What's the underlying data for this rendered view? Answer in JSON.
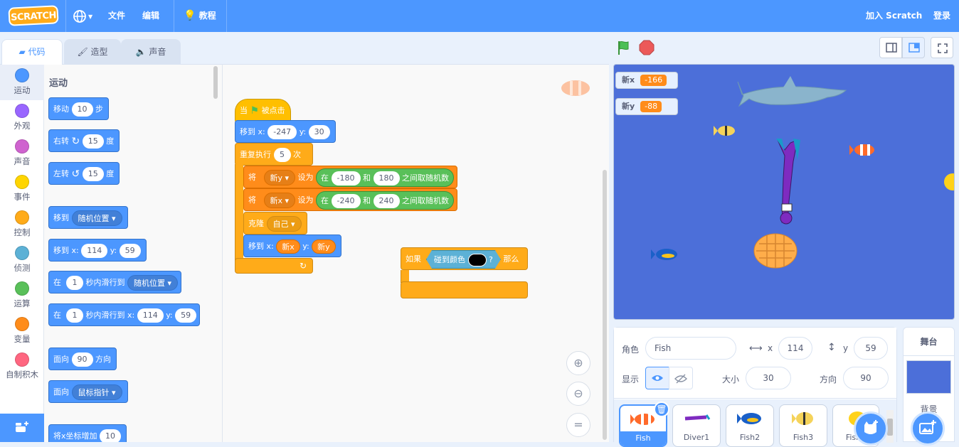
{
  "menubar": {
    "logo": "SCRATCH",
    "file": "文件",
    "edit": "编辑",
    "tutorials": "教程",
    "join": "加入 Scratch",
    "signin": "登录"
  },
  "tabs": {
    "code": "代码",
    "costumes": "造型",
    "sounds": "声音"
  },
  "categories": [
    {
      "label": "运动",
      "color": "#4c97ff"
    },
    {
      "label": "外观",
      "color": "#9966ff"
    },
    {
      "label": "声音",
      "color": "#cf63cf"
    },
    {
      "label": "事件",
      "color": "#ffd500"
    },
    {
      "label": "控制",
      "color": "#ffab19"
    },
    {
      "label": "侦测",
      "color": "#5cb1d6"
    },
    {
      "label": "运算",
      "color": "#59c059"
    },
    {
      "label": "变量",
      "color": "#ff8c1a"
    },
    {
      "label": "自制积木",
      "color": "#ff6680"
    }
  ],
  "palette": {
    "heading": "运动",
    "move": {
      "a": "移动",
      "v": "10",
      "b": "步"
    },
    "turn_right": {
      "a": "右转",
      "v": "15",
      "b": "度"
    },
    "turn_left": {
      "a": "左转",
      "v": "15",
      "b": "度"
    },
    "goto": {
      "a": "移到",
      "dd": "随机位置"
    },
    "gotoxy": {
      "a": "移到 x:",
      "x": "114",
      "yl": "y:",
      "y": "59"
    },
    "glide": {
      "a": "在",
      "v": "1",
      "b": "秒内滑行到",
      "dd": "随机位置"
    },
    "glidexy": {
      "a": "在",
      "v": "1",
      "b": "秒内滑行到 x:",
      "x": "114",
      "yl": "y:",
      "y": "59"
    },
    "point": {
      "a": "面向",
      "v": "90",
      "b": "方向"
    },
    "pointto": {
      "a": "面向",
      "dd": "鼠标指针"
    },
    "changex": {
      "a": "将x坐标增加",
      "v": "10"
    }
  },
  "script": {
    "hat": {
      "a": "当",
      "b": "被点击"
    },
    "gotoxy": {
      "a": "移到 x:",
      "x": "-247",
      "yl": "y:",
      "y": "30"
    },
    "repeat": {
      "a": "重复执行",
      "v": "5",
      "b": "次"
    },
    "sety": {
      "a": "将",
      "var": "新y",
      "b": "设为",
      "c": "在",
      "lo": "-180",
      "and": "和",
      "hi": "180",
      "d": "之间取随机数"
    },
    "setx": {
      "a": "将",
      "var": "新x",
      "b": "设为",
      "c": "在",
      "lo": "-240",
      "and": "和",
      "hi": "240",
      "d": "之间取随机数"
    },
    "clone": {
      "a": "克隆",
      "dd": "自己"
    },
    "goto2": {
      "a": "移到 x:",
      "x": "新x",
      "yl": "y:",
      "y": "新y"
    },
    "if": {
      "a": "如果",
      "touch": "碰到颜色",
      "q": "?",
      "b": "那么"
    }
  },
  "stage": {
    "monitors": [
      {
        "label": "新x",
        "value": "-166"
      },
      {
        "label": "新y",
        "value": "-88"
      }
    ]
  },
  "sprite_info": {
    "sprite_label": "角色",
    "name": "Fish",
    "x_label": "x",
    "x": "114",
    "y_label": "y",
    "y": "59",
    "show_label": "显示",
    "size_label": "大小",
    "size": "30",
    "direction_label": "方向",
    "direction": "90"
  },
  "sprites": [
    "Fish",
    "Diver1",
    "Fish2",
    "Fish3",
    "Fish4"
  ],
  "stage_panel": {
    "title": "舞台",
    "backdrops": "背景"
  }
}
